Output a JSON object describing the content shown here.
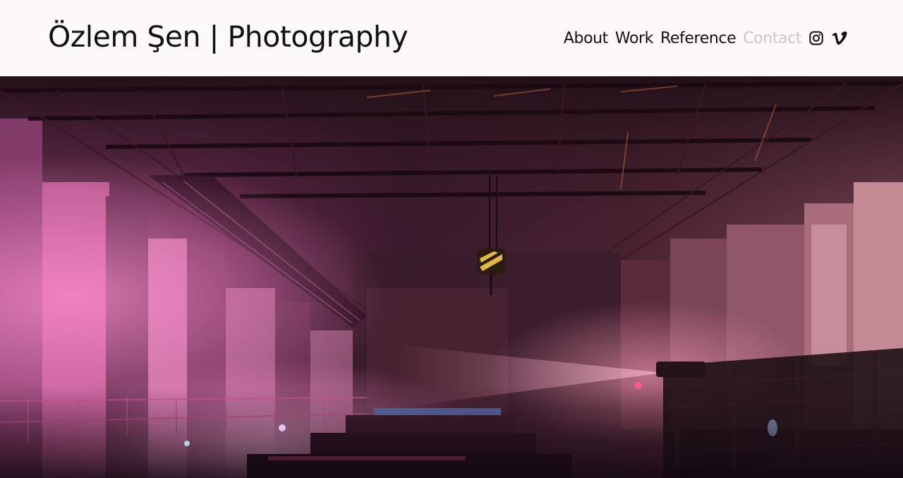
{
  "header": {
    "site_title": "Özlem Şen | Photography"
  },
  "nav": {
    "items": [
      {
        "label": "About",
        "active": true
      },
      {
        "label": "Work",
        "active": true
      },
      {
        "label": "Reference",
        "active": true
      },
      {
        "label": "Contact",
        "active": false
      }
    ],
    "social": [
      {
        "icon": "instagram-icon"
      },
      {
        "icon": "vimeo-icon"
      }
    ]
  },
  "hero": {
    "image": "industrial-hall-pink-light-photo",
    "colors": {
      "shadow": "#1a0d16",
      "mid": "#5a2a3e",
      "pink": "#e86aa8",
      "highlight": "#f7c0dc"
    }
  },
  "colors": {
    "background": "#fcf9f8",
    "text": "#111111",
    "inactive": "#c8c8c8"
  }
}
